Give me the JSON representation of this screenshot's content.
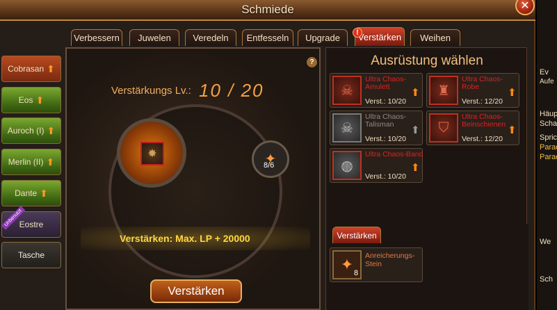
{
  "window": {
    "title": "Schmiede"
  },
  "tabs": [
    {
      "label": "Verbessern",
      "active": false
    },
    {
      "label": "Juwelen",
      "active": false
    },
    {
      "label": "Veredeln",
      "active": false
    },
    {
      "label": "Entfesseln",
      "active": false
    },
    {
      "label": "Upgrade",
      "active": false
    },
    {
      "label": "Verstärken",
      "active": true
    },
    {
      "label": "Weihen",
      "active": false
    }
  ],
  "sidebar": {
    "items": [
      {
        "label": "Cobrasan",
        "style": "red",
        "upgrade": true
      },
      {
        "label": "Eos",
        "style": "green",
        "upgrade": true
      },
      {
        "label": "Auroch (I)",
        "style": "green",
        "upgrade": true
      },
      {
        "label": "Merlin (II)",
        "style": "green",
        "upgrade": true
      },
      {
        "label": "Dante",
        "style": "green",
        "upgrade": true
      },
      {
        "label": "Eostre",
        "style": "purple",
        "upgrade": false,
        "badge": "Unbenutzt"
      },
      {
        "label": "Tasche",
        "style": "grey",
        "upgrade": false
      }
    ]
  },
  "main": {
    "level_label": "Verstärkungs Lv.:",
    "level_value": "10 / 20",
    "help": "?",
    "material_count": "8/6",
    "bonus_text": "Verstärken: Max. LP + 20000",
    "action_label": "Verstärken"
  },
  "equipment": {
    "title": "Ausrüstung wählen",
    "items": [
      {
        "name": "Ultra Chaos-Amulett",
        "verst": "Verst.: 10/20",
        "active": true,
        "icon": "amulet-icon"
      },
      {
        "name": "Ultra Chaos-Robe",
        "verst": "Verst.: 12/20",
        "active": true,
        "icon": "robe-icon"
      },
      {
        "name": "Ultra Chaos-Talisman",
        "verst": "Verst.: 10/20",
        "active": false,
        "icon": "talisman-icon"
      },
      {
        "name": "Ultra Chaos-Beinschienen",
        "verst": "Verst.: 12/20",
        "active": true,
        "icon": "leggings-icon"
      },
      {
        "name": "Ultra Chaos-Band",
        "verst": "Verst.: 10/20",
        "active": true,
        "icon": "ring-icon"
      }
    ]
  },
  "materials": {
    "tab_label": "Verstärken",
    "item": {
      "name": "Anreicherungs-Stein",
      "count": "8",
      "icon": "enrichment-stone-icon"
    }
  },
  "right_edge": {
    "lines": [
      "Ev",
      "Aufe",
      "Häup",
      "Scha",
      "Spric",
      "Parad",
      "Parad",
      "We",
      "Sch"
    ]
  },
  "colors": {
    "accent": "#d0422a",
    "upgrade_arrow": "#ff8a10",
    "gold_text": "#ffd840"
  }
}
